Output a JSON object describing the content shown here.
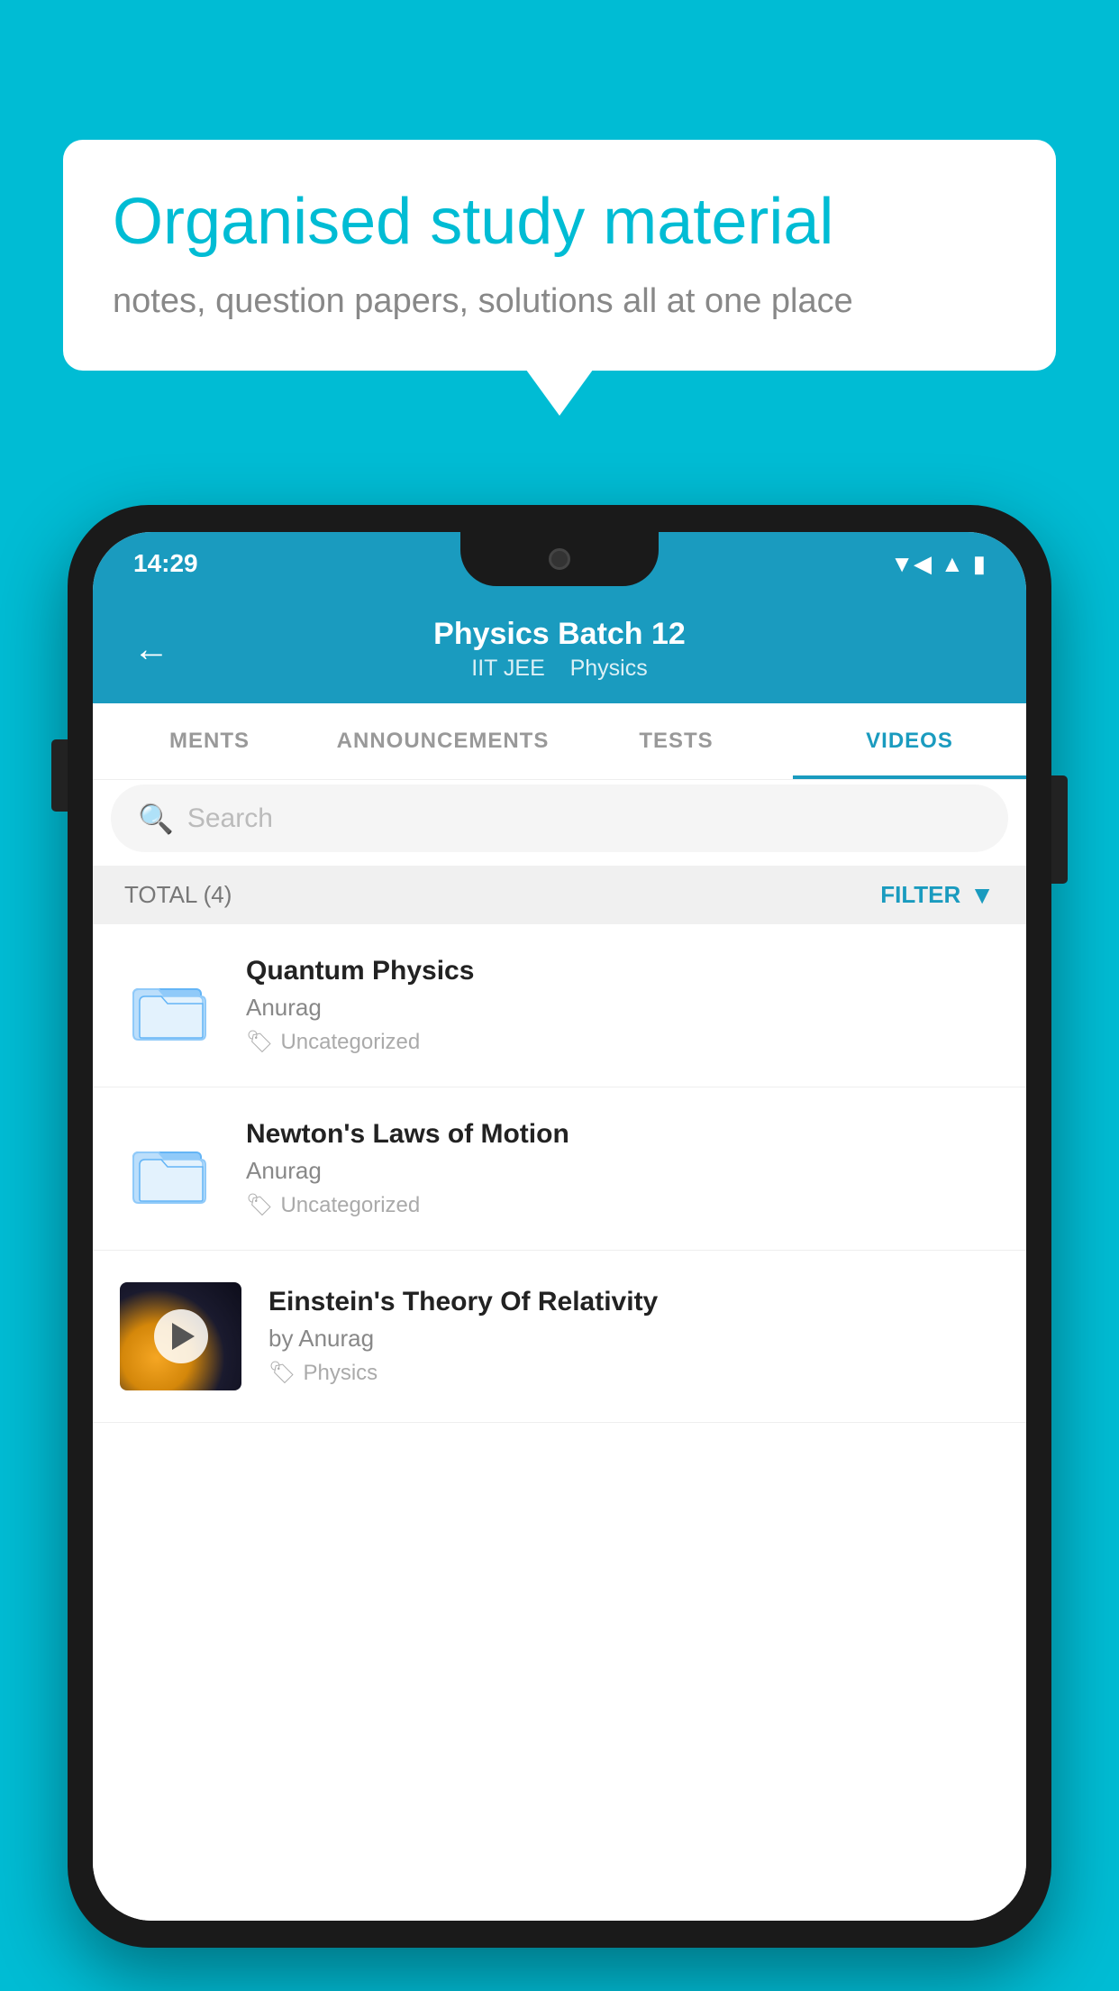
{
  "background_color": "#00bcd4",
  "speech_bubble": {
    "heading": "Organised study material",
    "subtext": "notes, question papers, solutions all at one place"
  },
  "status_bar": {
    "time": "14:29",
    "icons": [
      "wifi",
      "signal",
      "battery"
    ]
  },
  "app_header": {
    "back_label": "←",
    "title": "Physics Batch 12",
    "subtitle_part1": "IIT JEE",
    "subtitle_part2": "Physics"
  },
  "tabs": [
    {
      "label": "MENTS",
      "active": false
    },
    {
      "label": "ANNOUNCEMENTS",
      "active": false
    },
    {
      "label": "TESTS",
      "active": false
    },
    {
      "label": "VIDEOS",
      "active": true
    }
  ],
  "search": {
    "placeholder": "Search"
  },
  "filter": {
    "total_label": "TOTAL (4)",
    "filter_label": "FILTER"
  },
  "videos": [
    {
      "id": 1,
      "title": "Quantum Physics",
      "author": "Anurag",
      "tag": "Uncategorized",
      "thumbnail_type": "folder"
    },
    {
      "id": 2,
      "title": "Newton's Laws of Motion",
      "author": "Anurag",
      "tag": "Uncategorized",
      "thumbnail_type": "folder"
    },
    {
      "id": 3,
      "title": "Einstein's Theory Of Relativity",
      "author": "by Anurag",
      "tag": "Physics",
      "thumbnail_type": "video"
    }
  ]
}
